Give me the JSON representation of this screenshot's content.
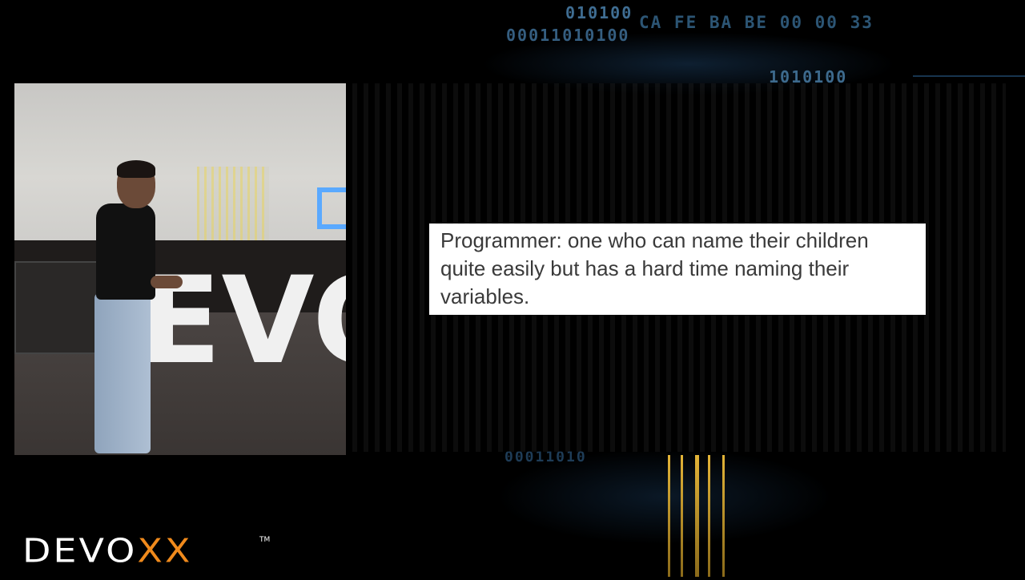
{
  "background": {
    "code_lines": [
      "010100",
      "00011010100",
      "CA FE BA BE 00 00 33",
      "1010100",
      "00011010"
    ],
    "accent": "#e3b438"
  },
  "video": {
    "stage_letters": "EVO"
  },
  "slide": {
    "quote_line1": "Programmer: one who can name their children",
    "quote_line2": "quite easily but has a hard time naming their",
    "quote_line3": "variables."
  },
  "logo": {
    "text_main": "DEVO",
    "text_xx": "XX",
    "trademark": "TM",
    "color": "#f08a1c"
  }
}
